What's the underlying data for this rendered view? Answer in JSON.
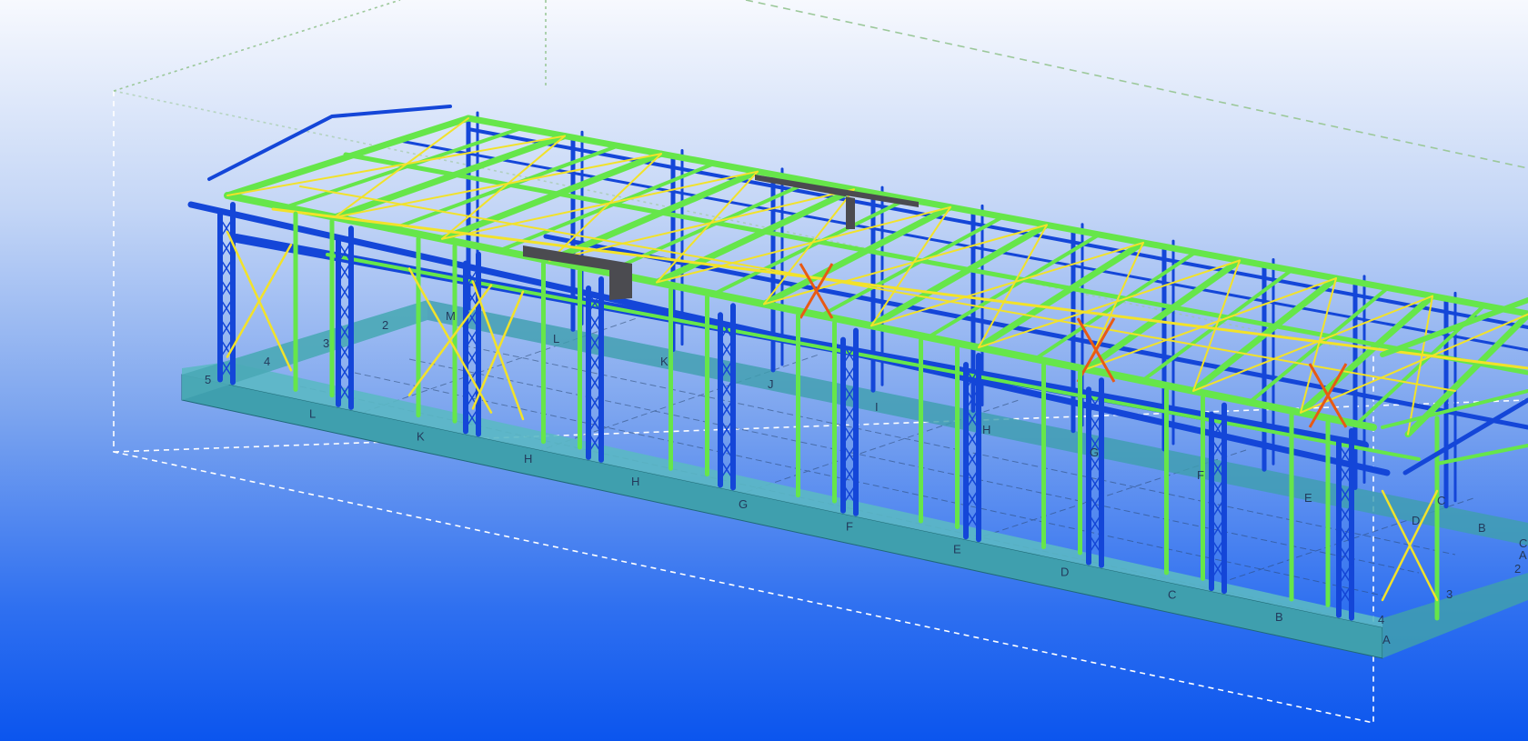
{
  "viewport": {
    "background_top": "#f7f9fe",
    "background_bottom": "#0b55ee"
  },
  "colors": {
    "steel_green": "#66e64a",
    "steel_blue": "#1446d8",
    "bracing_yellow": "#f2e22a",
    "bracing_orange": "#e85a14",
    "foundation_teal": "#3f9fae",
    "panel_dark": "#4b4b50",
    "bbox_line": "#ffffff",
    "grid_line": "#2a4770"
  },
  "grid_labels": {
    "front_letters": [
      "L",
      "K",
      "H",
      "H",
      "G",
      "F",
      "E",
      "D",
      "C",
      "B",
      "A"
    ],
    "back_letters": [
      "M",
      "L",
      "K",
      "J",
      "I",
      "H",
      "G",
      "F",
      "E",
      "D",
      "C"
    ],
    "left_numbers": [
      "2",
      "3",
      "4",
      "5"
    ],
    "right_numbers": [
      "2",
      "3",
      "4"
    ],
    "right_letters": [
      "C",
      "B",
      "A"
    ]
  }
}
